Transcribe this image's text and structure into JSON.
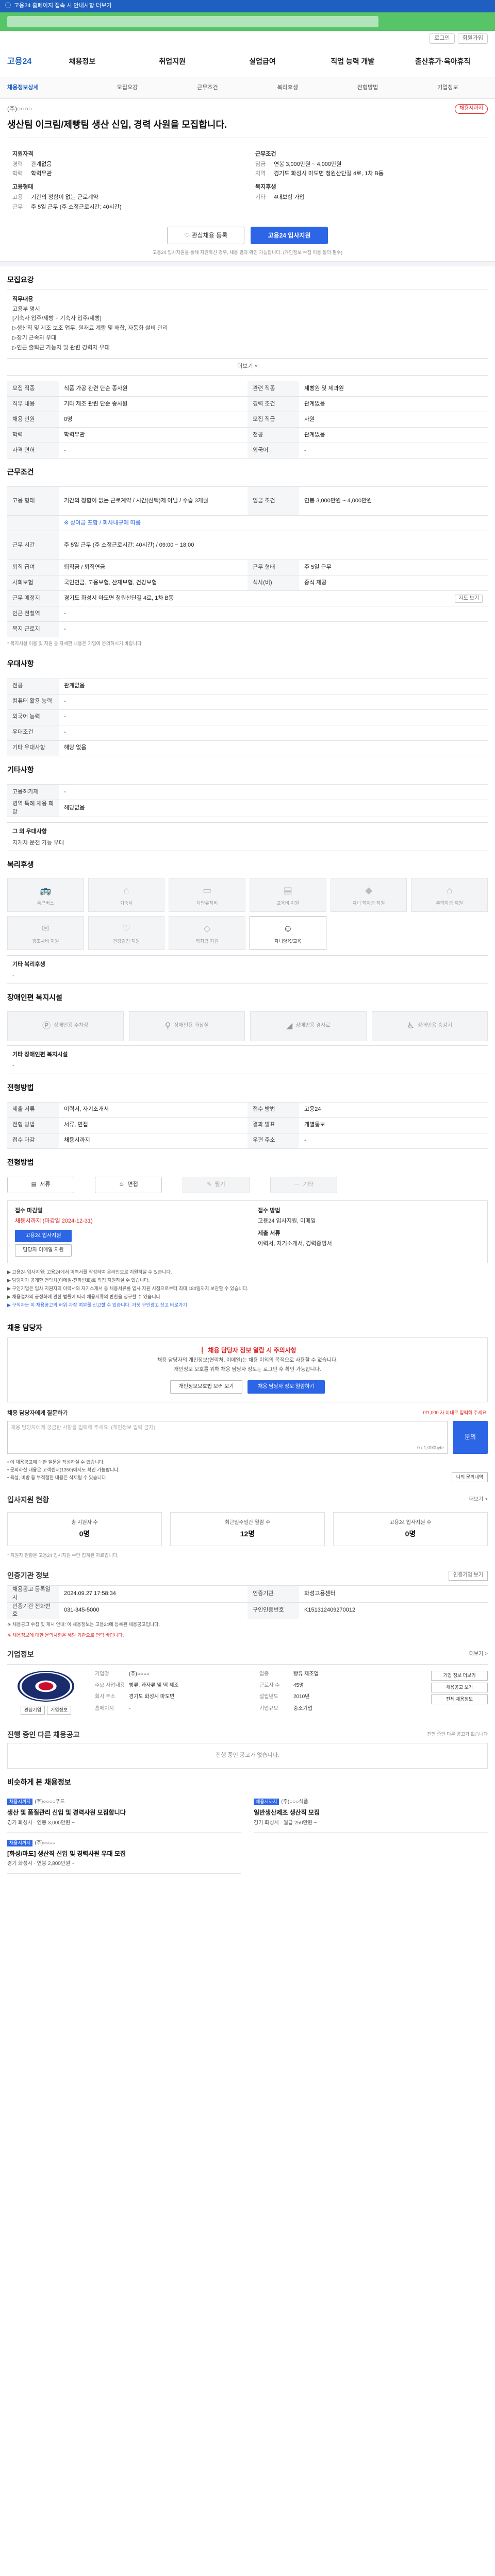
{
  "topbar": {
    "text": "고용24 홈페이지 접속 시 안내사항 더보기"
  },
  "util": {
    "btn1": "로그인",
    "btn2": "회원가입"
  },
  "gnb": {
    "logo": "고용24",
    "items": [
      "채용정보",
      "취업지원",
      "실업급여",
      "직업 능력 개발",
      "출산휴가·육아휴직"
    ]
  },
  "subnav": {
    "items": [
      "채용정보상세",
      "모집요강",
      "근무조건",
      "복리후생",
      "전형방법",
      "기업정보"
    ]
  },
  "header": {
    "company": "(주)○○○○",
    "badge": "채용시까지",
    "title": "생산팀 이크림/제빵팀 생산 신입, 경력 사원을 모집합니다."
  },
  "summary": {
    "left_title1": "지원자격",
    "left": [
      {
        "k": "경력",
        "v": "관계없음"
      },
      {
        "k": "학력",
        "v": "학력무관"
      }
    ],
    "left_title2": "고용형태",
    "left2": [
      {
        "k": "고용",
        "v": "기간의 정함이 없는 근로계약"
      },
      {
        "k": "근무",
        "v": "주 5일 근무 (주 소정근로시간: 40시간)"
      }
    ],
    "right_title1": "근무조건",
    "right": [
      {
        "k": "임금",
        "v": "연봉 3,000만원 ~ 4,000만원"
      },
      {
        "k": "지역",
        "v": "경기도 화성시 마도면 청원산단길 4로, 1차 B동"
      }
    ],
    "right_title2": "복지후생",
    "right2": [
      {
        "k": "기타",
        "v": "4대보험 가입"
      }
    ]
  },
  "apply": {
    "scrap": "관심채용 등록",
    "apply": "고용24 입사지원",
    "note": "고용24 입사지원을 통해 지원하신 경우, 채용 결과 확인 가능합니다. (개인정보 수집 이용 동의 필수)"
  },
  "recruit": {
    "section": "모집요강",
    "box_title": "직무내용",
    "box_sub": "고용부 명시",
    "lines": [
      "[기숙사 입주/제빵 + 기숙사 입주/제빵]",
      "▷생산직 및 제조 보조 업무, 원재료 계량 및 배합, 자동화 설비 관리",
      "▷장기 근속자 우대",
      "▷인근 출퇴근 가능자 및 관련 경력자 우대"
    ],
    "more": "더보기 ˅",
    "rows": [
      [
        {
          "k": "모집 직종",
          "v": "식품 가공 관련 단순 종사원"
        },
        {
          "k": "관련 직종",
          "v": "제빵원 및 제과원"
        }
      ],
      [
        {
          "k": "직무 내용",
          "v": "기타 제조 관련 단순 종사원"
        },
        {
          "k": "경력 조건",
          "v": "관계없음"
        }
      ],
      [
        {
          "k": "채용 인원",
          "v": "0명"
        },
        {
          "k": "모집 직급",
          "v": "사원"
        }
      ],
      [
        {
          "k": "학력",
          "v": "학력무관"
        },
        {
          "k": "전공",
          "v": "관계없음"
        }
      ],
      [
        {
          "k": "자격 면허",
          "v": "-"
        },
        {
          "k": "외국어",
          "v": "-"
        }
      ]
    ]
  },
  "cond": {
    "section": "근무조건",
    "emp_k": "고용 형태",
    "emp_v": "기간의 정함이 없는 근로계약 / 시간(선택)제 아님 / 수습 3개월",
    "wage_k": "임금 조건",
    "wage_v": "연봉 3,000만원 ~ 4,000만원",
    "extra": "※ 상여금 포함 / 회사내규에 따름",
    "time_k": "근무 시간",
    "time_v": "주 5일 근무 (주 소정근로시간: 40시간) / 09:00 ~ 18:00",
    "rows": [
      [
        {
          "k": "퇴직 급여",
          "v": "퇴직금 / 퇴직연금"
        },
        {
          "k": "근무 형태",
          "v": "주 5일 근무"
        }
      ],
      [
        {
          "k": "사회보험",
          "v": "국민연금, 고용보험, 산재보험, 건강보험"
        },
        {
          "k": "식사(비)",
          "v": "중식 제공"
        }
      ]
    ],
    "place_k": "근무 예정지",
    "place_v": "경기도 화성시 마도면 청원산단길 4로, 1차 B동",
    "map": "지도 보기",
    "r1": [
      {
        "k": "인근 전철역",
        "v": "-"
      }
    ],
    "r2": [
      {
        "k": "복지 근로지",
        "v": "-"
      }
    ],
    "note": "* 복지시설 이용 및 지원 등 자세한 내용은 기업에 문의하시기 바랍니다."
  },
  "prefer": {
    "section": "우대사항",
    "rows": [
      {
        "k": "전공",
        "v": "관계없음"
      },
      {
        "k": "컴퓨터 활용 능력",
        "v": "-"
      },
      {
        "k": "외국어 능력",
        "v": "-"
      },
      {
        "k": "우대조건",
        "v": "-"
      },
      {
        "k": "기타 우대사항",
        "v": "해당 없음"
      }
    ]
  },
  "etc": {
    "section": "기타사항",
    "rows": [
      {
        "k": "고용허가제",
        "v": "-"
      },
      {
        "k": "병역 특례 채용 희망",
        "v": "해당없음"
      }
    ],
    "box_title": "그 외 우대사항",
    "box_text": "지게차 운전 가능 우대"
  },
  "welfare": {
    "section": "복리후생",
    "items": [
      "통근버스",
      "기숙사",
      "차량유지비",
      "교육비 지원",
      "자녀 학자금 지원",
      "주택자금 지원",
      "경조사비 지원",
      "건강검진 지원",
      "학자금 지원",
      "자녀양육/교육"
    ],
    "box_title": "기타 복리후생",
    "box_text": "-"
  },
  "disab": {
    "section": "장애인편 복지시설",
    "items": [
      "장애인용 주차장",
      "장애인용 화장실",
      "장애인용 경사로",
      "장애인용 승강기"
    ],
    "box_title": "기타 장애인편 복지시설",
    "box_text": "-"
  },
  "process": {
    "section": "전형방법",
    "rows": [
      [
        {
          "k": "제출 서류",
          "v": "이력서, 자기소개서"
        },
        {
          "k": "접수 방법",
          "v": "고용24"
        }
      ],
      [
        {
          "k": "전형 방법",
          "v": "서류, 면접"
        },
        {
          "k": "결과 발표",
          "v": "개별통보"
        }
      ],
      [
        {
          "k": "접수 마감",
          "v": "채용시까지"
        },
        {
          "k": "우편 주소",
          "v": "-"
        }
      ]
    ]
  },
  "steps": {
    "section": "전형방법",
    "items": [
      {
        "label": "서류",
        "on": true
      },
      {
        "label": "면접",
        "on": true
      },
      {
        "label": "필기",
        "on": false
      },
      {
        "label": "기타",
        "on": false
      }
    ]
  },
  "applybox": {
    "l_label": "접수 마감일",
    "l_val": "채용시까지 (마감일 2024-12-31)",
    "btn1": "고용24 입사지원",
    "btn2": "담당자 이메일 지원",
    "r_label": "접수 방법",
    "r_val": "고용24 입사지원, 이메일",
    "r_label2": "제출 서류",
    "r_val2": "이력서, 자기소개서, 경력증명서",
    "bullets": [
      "▶ 고용24 입사지원: 고용24에서 이력서를 작성하여 온라인으로 지원하실 수 있습니다.",
      "▶ 담당자가 공개한 연락처(이메일·전화번호)로 직접 지원하실 수 있습니다.",
      "▶ 구인기업은 입사 지원자의 이력서와 자기소개서 등 채용서류를 입사 지원 시점으로부터 최대 180일까지 보관할 수 있습니다.",
      "▶ 채용절차의 공정화에 관한 법률에 따라 채용서류의 반환을 청구할 수 있습니다.",
      "▶ 구직자는 이 채용공고의 허위·과장 여부를 신고할 수 있습니다. 거짓 구인광고 신고 바로가기"
    ]
  },
  "contact": {
    "section": "채용 담당자",
    "warn_title": "채용 담당자 정보 열람 시 주의사항",
    "warn_text": "채용 담당자의 개인정보(연락처, 이메일)는 채용 이외의 목적으로 사용할 수 없습니다.",
    "warn_text2": "개인정보 보호를 위해 채용 담당자 정보는 로그인 후 확인 가능합니다.",
    "btn1": "개인정보보호법 보러 보기",
    "btn2": "채용 담당자 정보 열람하기"
  },
  "inquiry": {
    "title": "채용 담당자에게 질문하기",
    "right": "0/1,000 자 이내로 입력해 주세요.",
    "placeholder": "채용 담당자에게 궁금한 사항을 입력해 주세요. (개인정보 입력 금지)",
    "count": "0 / 1,000byte",
    "btn": "문의",
    "notes": [
      "• 이 채용공고에 대한 질문을 작성하실 수 있습니다.",
      "• 문의하신 내용은 고객센터(1350)에서도 확인 가능합니다.",
      "• 욕설, 비방 등 부적절한 내용은 삭제될 수 있습니다."
    ],
    "mybtn": "나의 문의내역"
  },
  "stats": {
    "section": "입사지원 현황",
    "more": "더보기 >",
    "items": [
      {
        "l": "총 지원자 수",
        "n": "0명"
      },
      {
        "l": "최근일주일간 열람 수",
        "n": "12명"
      },
      {
        "l": "고용24 입사지원 수",
        "n": "0명"
      }
    ],
    "note": "* 지원자 현황은 고용24 입사지원 수만 집계된 자료입니다."
  },
  "reg": {
    "section": "인증기관 정보",
    "btn": "인증기업 보기",
    "rows": [
      [
        {
          "k": "채용공고 등록일시",
          "v": "2024.09.27 17:58:34"
        },
        {
          "k": "인증기관",
          "v": "화성고용센터"
        }
      ],
      [
        {
          "k": "인증기관 전화번호",
          "v": "031-345-5000"
        },
        {
          "k": "구인인증번호",
          "v": "K151312409270012"
        }
      ]
    ],
    "notes": [
      "※ 채용공고 수집 및 게시 안내: 이 채용정보는 고용24에 등록된 채용공고입니다.",
      "※ 채용정보에 대한 문의사항은 해당 기관으로 연락 바랍니다."
    ]
  },
  "company": {
    "section": "기업정보",
    "more": "더보기 >",
    "btns": [
      "관심기업",
      "기업정보"
    ],
    "info": [
      {
        "k": "기업명",
        "v": "(주)○○○○"
      },
      {
        "k": "업종",
        "v": "빵류 제조업"
      },
      {
        "k": "주요 사업내용",
        "v": "빵류, 과자류 및 떡 제조"
      },
      {
        "k": "근로자 수",
        "v": "45명"
      },
      {
        "k": "회사 주소",
        "v": "경기도 화성시 마도면"
      },
      {
        "k": "설립년도",
        "v": "2010년"
      },
      {
        "k": "홈페이지",
        "v": "-"
      },
      {
        "k": "기업규모",
        "v": "중소기업"
      }
    ],
    "side": [
      "기업 정보 더보기",
      "채용공고 보기",
      "전체 채용정보"
    ]
  },
  "same": {
    "section": "진행 중인 다른 채용공고",
    "right": "진행 중인 다른 공고가 없습니다",
    "empty": "진행 중인 공고가 없습니다."
  },
  "similar": {
    "section": "비슷하게 본 채용정보",
    "cards": [
      {
        "tag": "채용시까지",
        "cp": "(주)○○○○푸드",
        "tt": "생산 및 품질관리 신입 및 경력사원 모집합니다",
        "mt": "경기 화성시 · 연봉 3,000만원 ~"
      },
      {
        "tag": "채용시까지",
        "cp": "(주)○○○식품",
        "tt": "일반생산제조 생산직 모집",
        "mt": "경기 화성시 · 월급 250만원 ~"
      },
      {
        "tag": "채용시까지",
        "cp": "(주)○○○○",
        "tt": "[화성/마도] 생산직 신입 및 경력사원 우대 모집",
        "mt": "경기 화성시 · 연봉 2,800만원 ~"
      }
    ]
  }
}
